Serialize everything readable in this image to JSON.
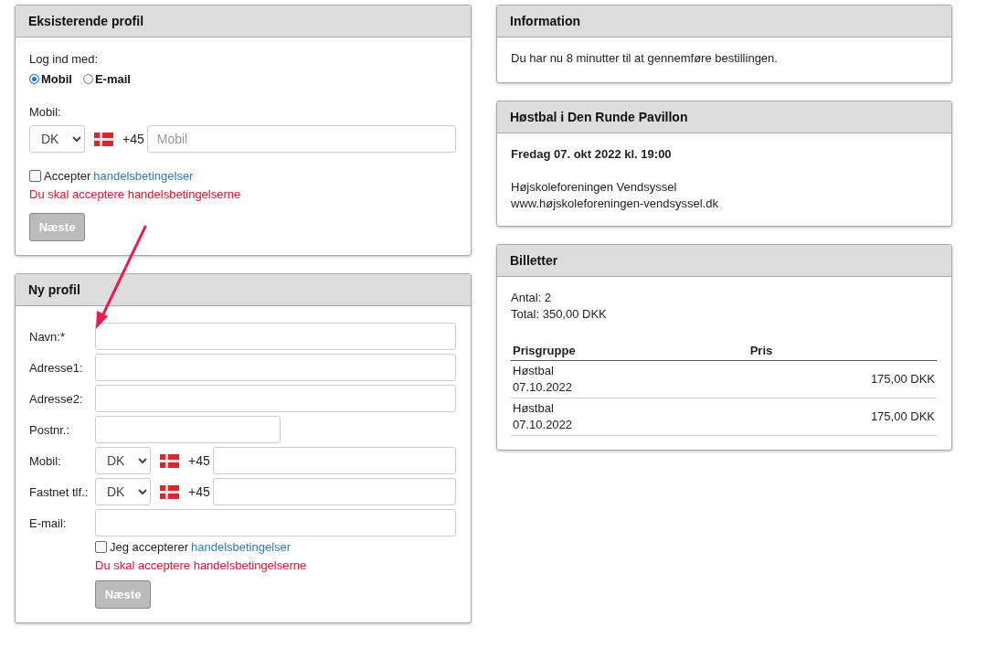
{
  "existing_profile": {
    "title": "Eksisterende profil",
    "login_label": "Log ind med:",
    "login_options": [
      {
        "label": "Mobil",
        "selected": true
      },
      {
        "label": "E-mail",
        "selected": false
      }
    ],
    "phone_label": "Mobil:",
    "country": "DK",
    "prefix": "+45",
    "phone_placeholder": "Mobil",
    "terms": {
      "checked": false,
      "text": "Accepter",
      "link": "handelsbetingelser"
    },
    "error": "Du skal acceptere handelsbetingelserne",
    "button": {
      "label": "Næste",
      "disabled": true
    }
  },
  "new_profile": {
    "title": "Ny profil",
    "fields": [
      {
        "kind": "text",
        "label": "Navn:*"
      },
      {
        "kind": "text",
        "label": "Adresse1:"
      },
      {
        "kind": "text",
        "label": "Adresse2:"
      },
      {
        "kind": "short",
        "label": "Postnr.:"
      },
      {
        "kind": "phone",
        "label": "Mobil:",
        "country": "DK",
        "prefix": "+45"
      },
      {
        "kind": "phone",
        "label": "Fastnet tlf.:",
        "country": "DK",
        "prefix": "+45"
      },
      {
        "kind": "text",
        "label": "E-mail:"
      }
    ],
    "terms": {
      "checked": false,
      "text": "Jeg accepterer",
      "link": "handelsbetingelser"
    },
    "error": "Du skal acceptere handelsbetingelserne",
    "button": {
      "label": "Næste",
      "disabled": true
    }
  },
  "information": {
    "title": "Information",
    "text": "Du har nu 8 minutter til at gennemføre bestillingen."
  },
  "event": {
    "title": "Høstbal i Den Runde Pavillon",
    "date": "Fredag 07. okt 2022 kl. 19:00",
    "organizer": "Højskoleforeningen Vendsyssel",
    "website": "www.højskoleforeningen-vendsyssel.dk"
  },
  "tickets": {
    "title": "Billetter",
    "count": "Antal: 2",
    "total": "Total: 350,00 DKK",
    "columns": [
      "Prisgruppe",
      "Pris"
    ],
    "rows": [
      {
        "group": "Høstbal 07.10.2022",
        "price": "175,00 DKK"
      },
      {
        "group": "Høstbal 07.10.2022",
        "price": "175,00 DKK"
      }
    ]
  }
}
